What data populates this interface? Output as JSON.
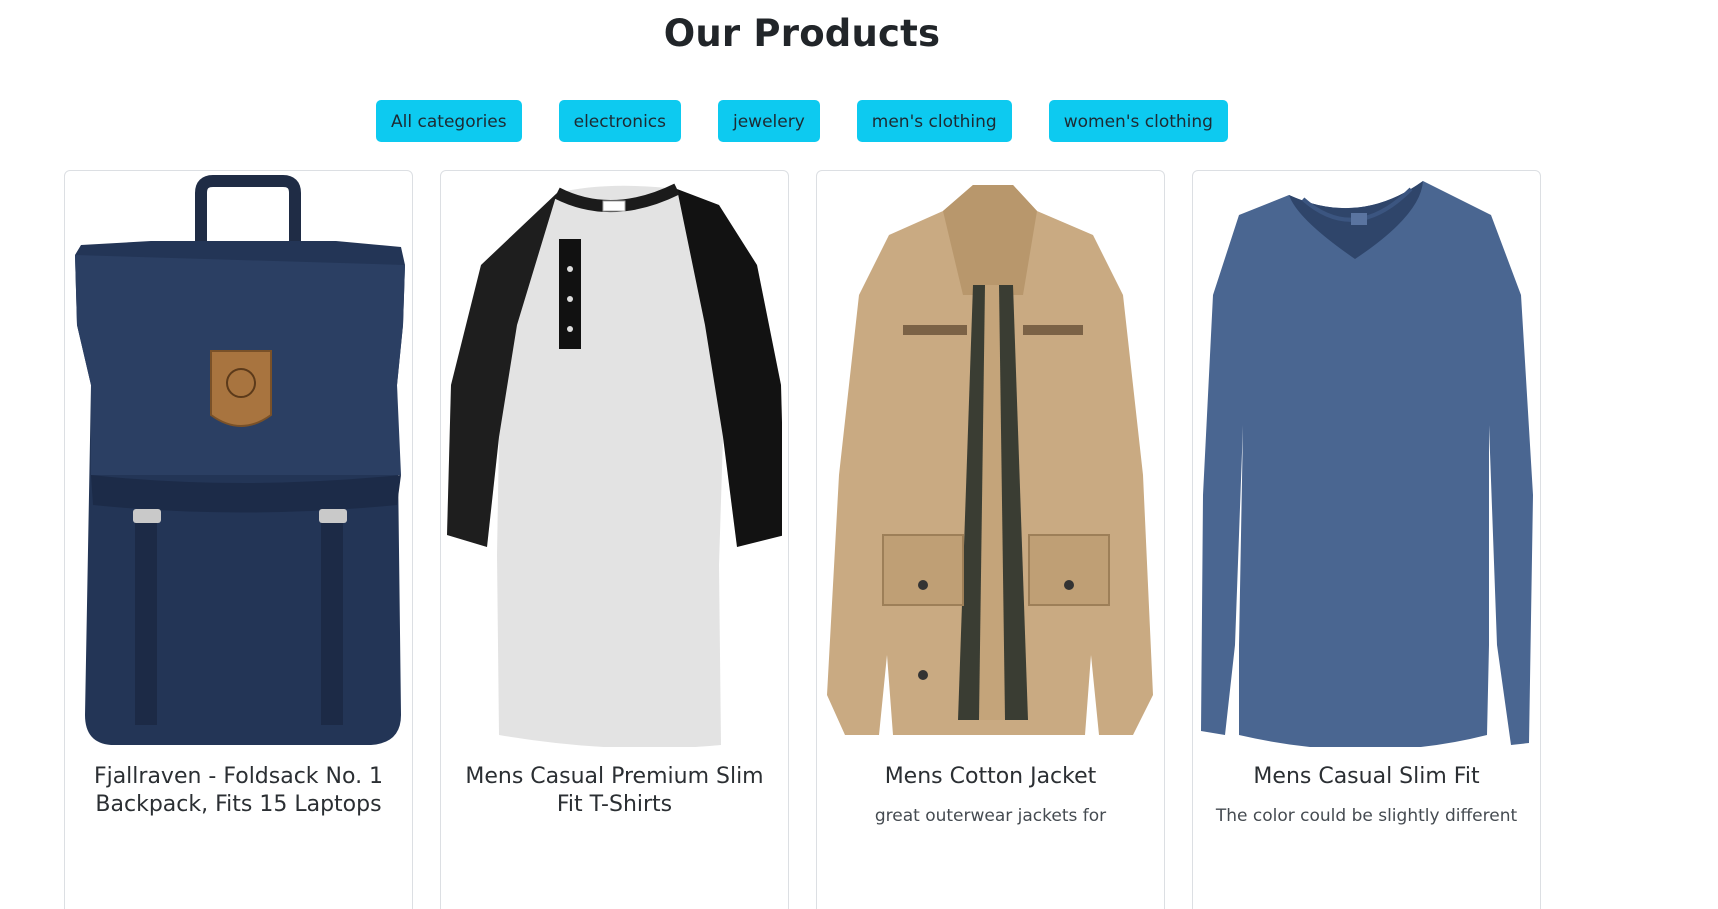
{
  "header": {
    "title": "Our Products"
  },
  "filters": [
    {
      "label": "All categories"
    },
    {
      "label": "electronics"
    },
    {
      "label": "jewelery"
    },
    {
      "label": "men's clothing"
    },
    {
      "label": "women's clothing"
    }
  ],
  "colors": {
    "accent": "#0dcaf0"
  },
  "products": [
    {
      "title": "Fjallraven - Foldsack No. 1 Backpack, Fits 15 Laptops",
      "description": "",
      "image_icon": "backpack-icon"
    },
    {
      "title": "Mens Casual Premium Slim Fit T-Shirts",
      "description": "",
      "image_icon": "raglan-shirt-icon"
    },
    {
      "title": "Mens Cotton Jacket",
      "description": "great outerwear jackets for",
      "image_icon": "jacket-icon"
    },
    {
      "title": "Mens Casual Slim Fit",
      "description": "The color could be slightly different",
      "image_icon": "long-sleeve-shirt-icon"
    }
  ]
}
